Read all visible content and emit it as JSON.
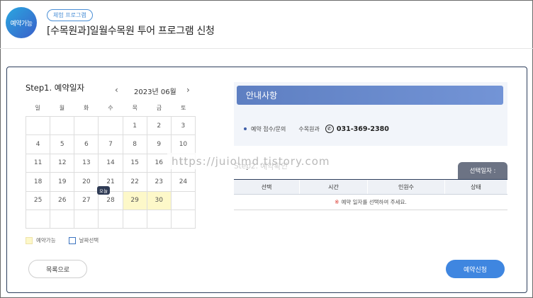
{
  "header": {
    "avatar_label": "예약가능",
    "badge": "체험 프로그램",
    "title": "[수목원과]일월수목원 투어 프로그램 신청"
  },
  "calendar": {
    "step_title": "Step1. 예약일자",
    "month_label": "2023년 06월",
    "prev_icon": "chevron-left-icon",
    "next_icon": "chevron-right-icon",
    "prev_glyph": "‹",
    "next_glyph": "›",
    "weekdays": [
      "일",
      "월",
      "화",
      "수",
      "목",
      "금",
      "토"
    ],
    "weeks": [
      [
        "",
        "",
        "",
        "",
        "1",
        "2",
        "3"
      ],
      [
        "4",
        "5",
        "6",
        "7",
        "8",
        "9",
        "10"
      ],
      [
        "11",
        "12",
        "13",
        "14",
        "15",
        "16",
        "17"
      ],
      [
        "18",
        "19",
        "20",
        "21",
        "22",
        "23",
        "24"
      ],
      [
        "25",
        "26",
        "27",
        "28",
        "29",
        "30",
        ""
      ],
      [
        "",
        "",
        "",
        "",
        "",
        "",
        ""
      ]
    ],
    "available_days": [
      "29",
      "30"
    ],
    "today_day": "28",
    "today_label": "오늘",
    "available_color": "#fdf8c9"
  },
  "legend": {
    "available": "예약가능",
    "selected": "날짜선택"
  },
  "buttons": {
    "list": "목록으로",
    "reserve": "예약신청"
  },
  "notice": {
    "title": "안내사항",
    "contact_label": "예약 접수/문의",
    "org": "수목원과",
    "phone_icon": "phone-icon",
    "phone_glyph": "✆",
    "phone": "031-369-2380"
  },
  "confirm": {
    "step_title": "Step2. 예약확인",
    "selected_date_tab": "선택일자 :",
    "columns": [
      "선택",
      "시간",
      "인원수",
      "상태"
    ],
    "empty_mark": "※",
    "empty_message": "예약 일자를 선택하여 주세요."
  },
  "watermark": "https://juiolmd.tistory.com"
}
